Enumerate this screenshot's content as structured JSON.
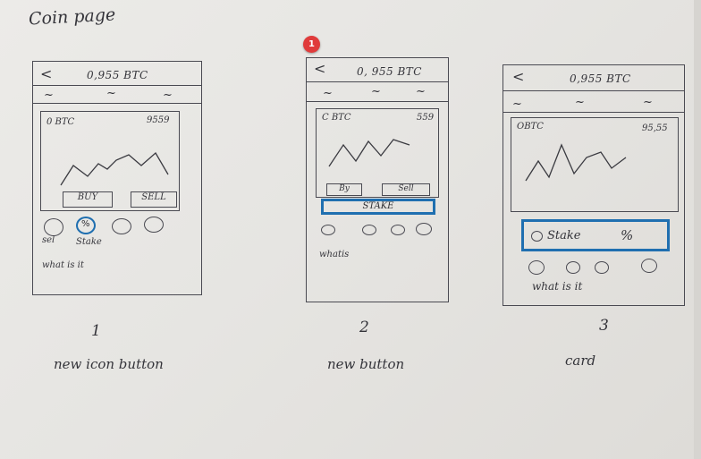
{
  "page_title": "Coin page",
  "marker": "1",
  "sketches": [
    {
      "header": {
        "back": "<",
        "balance": "0,955 BTC"
      },
      "tabs": [
        "~",
        "~",
        "~"
      ],
      "card": {
        "coin": "0 BTC",
        "value": "9559"
      },
      "buttons": {
        "buy": "BUY",
        "sell": "SELL"
      },
      "icon_labels": {
        "sell": "sel",
        "stake": "Stake"
      },
      "footer_text": "what is it",
      "number": "1",
      "caption": "new icon button"
    },
    {
      "header": {
        "back": "<",
        "balance": "0, 955 BTC"
      },
      "tabs": [
        "~",
        "~",
        "~"
      ],
      "card": {
        "coin": "C BTC",
        "value": "559"
      },
      "buttons": {
        "buy": "By",
        "sell": "Sell",
        "stake": "STAKE"
      },
      "footer_text": "whatis",
      "number": "2",
      "caption": "new button"
    },
    {
      "header": {
        "back": "<",
        "balance": "0,955 BTC"
      },
      "tabs": [
        "~",
        "~",
        "~"
      ],
      "card": {
        "coin": "OBTC",
        "value": "95,55"
      },
      "stake_card": {
        "label": "Stake",
        "symbol": "%"
      },
      "footer_text": "what is it",
      "number": "3",
      "caption": "card"
    }
  ]
}
